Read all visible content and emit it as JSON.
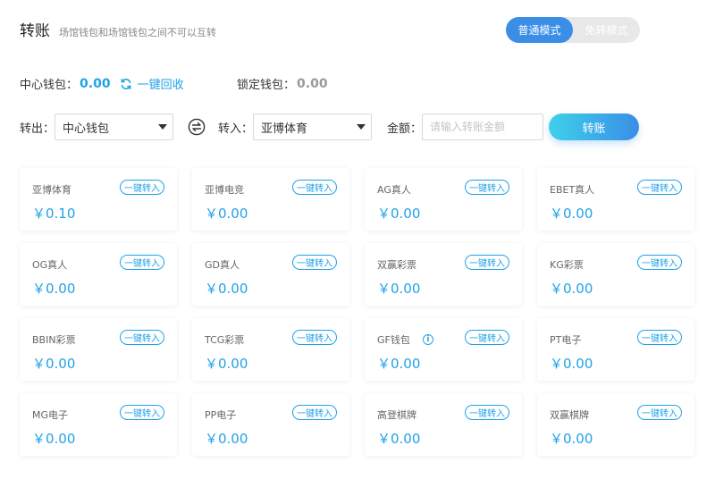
{
  "header": {
    "title": "转账",
    "subtitle": "场馆钱包和场馆钱包之间不可以互转"
  },
  "mode": {
    "options": [
      "普通模式",
      "免转模式"
    ],
    "active": "普通模式"
  },
  "wallet": {
    "central_label": "中心钱包：",
    "central_amount": "0.00",
    "refresh_icon": "refresh-icon",
    "recover_label": "一键回收",
    "locked_label": "锁定钱包：",
    "locked_amount": "0.00"
  },
  "transfer": {
    "out_label": "转出：",
    "out_value": "中心钱包",
    "swap_icon": "swap-icon",
    "in_label": "转入：",
    "in_value": "亚博体育",
    "amount_label": "金额：",
    "amount_placeholder": "请输入转账金额",
    "submit_label": "转账"
  },
  "colors": {
    "accent": "#1fa2e8",
    "primary": "#3b8ee6",
    "gradient_start": "#3fd0ea",
    "gradient_end": "#3a8ee6"
  },
  "venues": [
    {
      "name": "亚博体育",
      "balance": "￥0.10",
      "button": "一键转入",
      "info": false
    },
    {
      "name": "亚博电竞",
      "balance": "￥0.00",
      "button": "一键转入",
      "info": false
    },
    {
      "name": "AG真人",
      "balance": "￥0.00",
      "button": "一键转入",
      "info": false
    },
    {
      "name": "EBET真人",
      "balance": "￥0.00",
      "button": "一键转入",
      "info": false
    },
    {
      "name": "OG真人",
      "balance": "￥0.00",
      "button": "一键转入",
      "info": false
    },
    {
      "name": "GD真人",
      "balance": "￥0.00",
      "button": "一键转入",
      "info": false
    },
    {
      "name": "双赢彩票",
      "balance": "￥0.00",
      "button": "一键转入",
      "info": false
    },
    {
      "name": "KG彩票",
      "balance": "￥0.00",
      "button": "一键转入",
      "info": false
    },
    {
      "name": "BBIN彩票",
      "balance": "￥0.00",
      "button": "一键转入",
      "info": false
    },
    {
      "name": "TCG彩票",
      "balance": "￥0.00",
      "button": "一键转入",
      "info": false
    },
    {
      "name": "GF钱包",
      "balance": "￥0.00",
      "button": "一键转入",
      "info": true
    },
    {
      "name": "PT电子",
      "balance": "￥0.00",
      "button": "一键转入",
      "info": false
    },
    {
      "name": "MG电子",
      "balance": "￥0.00",
      "button": "一键转入",
      "info": false
    },
    {
      "name": "PP电子",
      "balance": "￥0.00",
      "button": "一键转入",
      "info": false
    },
    {
      "name": "高登棋牌",
      "balance": "￥0.00",
      "button": "一键转入",
      "info": false
    },
    {
      "name": "双赢棋牌",
      "balance": "￥0.00",
      "button": "一键转入",
      "info": false
    }
  ]
}
